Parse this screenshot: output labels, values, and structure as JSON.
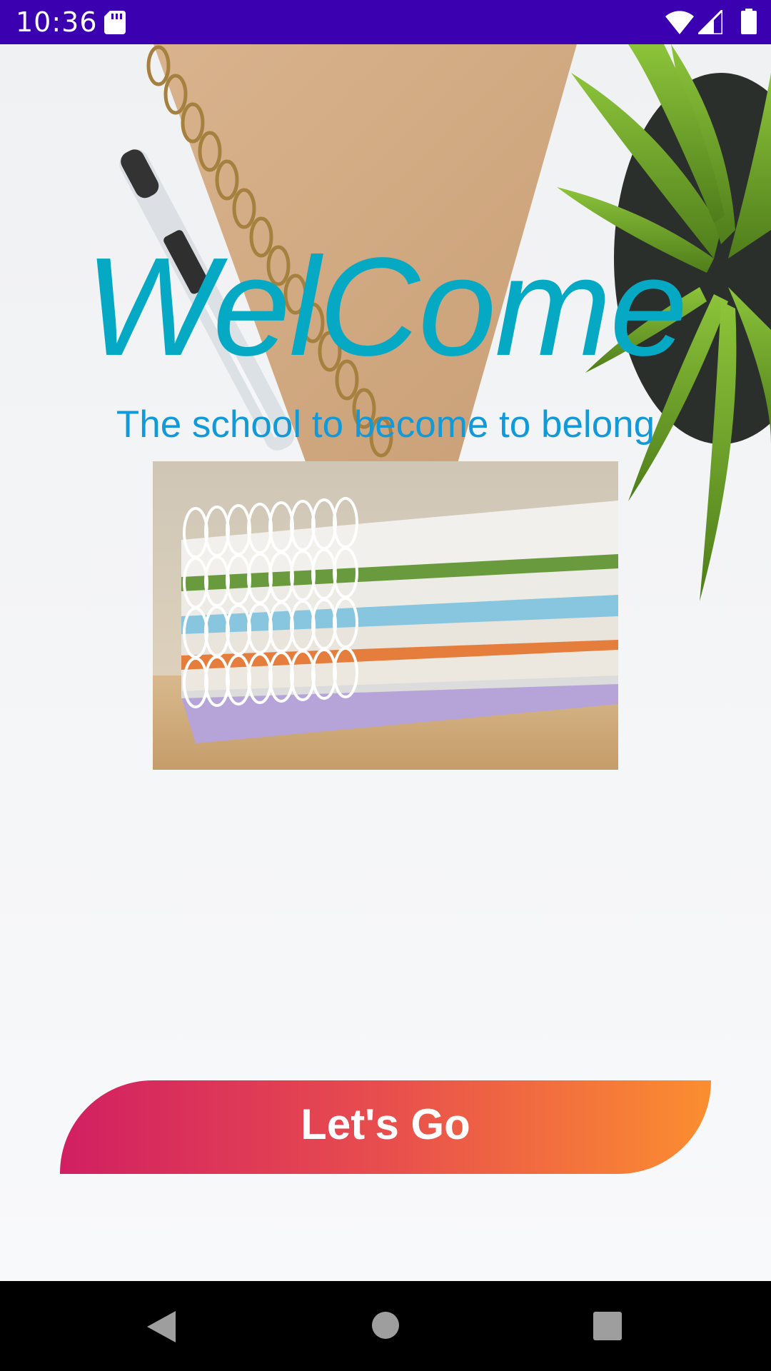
{
  "status_bar": {
    "time": "10:36",
    "icons": [
      "sd-card-icon",
      "wifi-icon",
      "signal-icon",
      "battery-icon"
    ]
  },
  "main": {
    "title": "WelCome",
    "tagline": "The school to become to belong",
    "photo": "stacked-spiral-notebooks-image",
    "background": "desk-with-notebook-pen-and-plant-image"
  },
  "cta": {
    "label": "Let's Go",
    "gradient_start": "#d11f62",
    "gradient_end": "#fb8e30"
  },
  "colors": {
    "status_bar": "#3b00b0",
    "title": "#06a9c4",
    "tagline": "#1199d8"
  },
  "nav_bar": {
    "icons": [
      "back-icon",
      "home-icon",
      "recents-icon"
    ]
  }
}
